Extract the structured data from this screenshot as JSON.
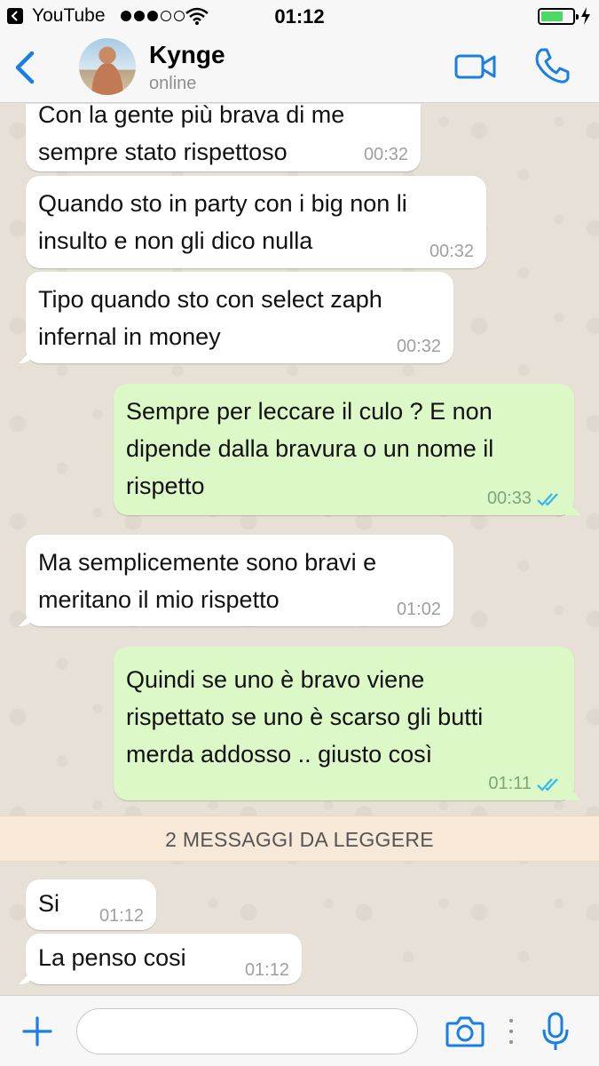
{
  "status_bar": {
    "back_app": "YouTube",
    "time": "01:12",
    "signal_bars_filled": 3,
    "signal_bars_total": 5,
    "battery_level": 0.7
  },
  "header": {
    "contact_name": "Kynge",
    "contact_status": "online"
  },
  "messages": [
    {
      "direction": "in",
      "lines": [
        "Con la gente più brava di me",
        "sempre stato rispettoso"
      ],
      "time": "00:32"
    },
    {
      "direction": "in",
      "lines": [
        "Quando sto in party con i big non li",
        "insulto e non gli dico nulla"
      ],
      "time": "00:32"
    },
    {
      "direction": "in",
      "lines": [
        "Tipo quando sto con select zaph",
        "infernal in money"
      ],
      "time": "00:32"
    },
    {
      "direction": "out",
      "lines": [
        "Sempre per leccare il culo ? E non",
        "dipende dalla bravura o un nome il",
        "rispetto"
      ],
      "time": "00:33"
    },
    {
      "direction": "in",
      "lines": [
        "Ma semplicemente sono bravi e",
        "meritano il mio rispetto"
      ],
      "time": "01:02"
    },
    {
      "direction": "out",
      "lines": [
        "Quindi se uno è bravo viene",
        "rispettato se uno è scarso gli butti",
        "merda addosso .. giusto così"
      ],
      "time": "01:11"
    },
    {
      "direction": "in",
      "lines": [
        "Si"
      ],
      "time": "01:12"
    },
    {
      "direction": "in",
      "lines": [
        "La penso cosi"
      ],
      "time": "01:12"
    }
  ],
  "unread_banner": "2 MESSAGGI DA LEGGERE",
  "input": {
    "placeholder": "",
    "value": ""
  },
  "colors": {
    "accent": "#1a7fe3",
    "outgoing_bubble": "#dcf8c6",
    "incoming_bubble": "#ffffff",
    "read_ticks": "#34b7f1",
    "unread_banner": "#f7e8d8"
  }
}
